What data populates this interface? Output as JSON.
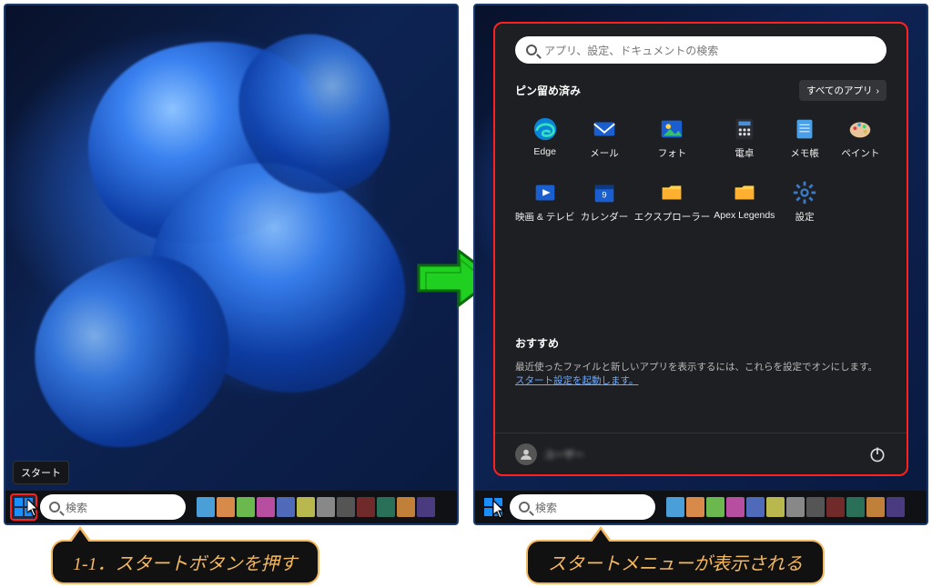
{
  "left_panel": {
    "start_tooltip": "スタート",
    "search_placeholder": "検索"
  },
  "right_panel": {
    "search_placeholder": "検索",
    "startmenu": {
      "search_placeholder": "アプリ、設定、ドキュメントの検索",
      "pinned_label": "ピン留め済み",
      "all_apps_label": "すべてのアプリ",
      "apps": [
        {
          "name": "Edge",
          "icon": "edge"
        },
        {
          "name": "メール",
          "icon": "mail"
        },
        {
          "name": "フォト",
          "icon": "photos"
        },
        {
          "name": "電卓",
          "icon": "calc"
        },
        {
          "name": "メモ帳",
          "icon": "notepad"
        },
        {
          "name": "ペイント",
          "icon": "paint"
        },
        {
          "name": "映画 & テレビ",
          "icon": "movies"
        },
        {
          "name": "カレンダー",
          "icon": "calendar"
        },
        {
          "name": "エクスプローラー",
          "icon": "explorer"
        },
        {
          "name": "Apex Legends",
          "icon": "folder"
        },
        {
          "name": "設定",
          "icon": "settings"
        }
      ],
      "recommended_label": "おすすめ",
      "recommended_text": "最近使ったファイルと新しいアプリを表示するには、これらを設定でオンにします。",
      "recommended_link": "スタート設定を起動します。",
      "user_name": "ユーザー"
    }
  },
  "callout_left": "1-1．スタートボタンを押す",
  "callout_right": "スタートメニューが表示される"
}
